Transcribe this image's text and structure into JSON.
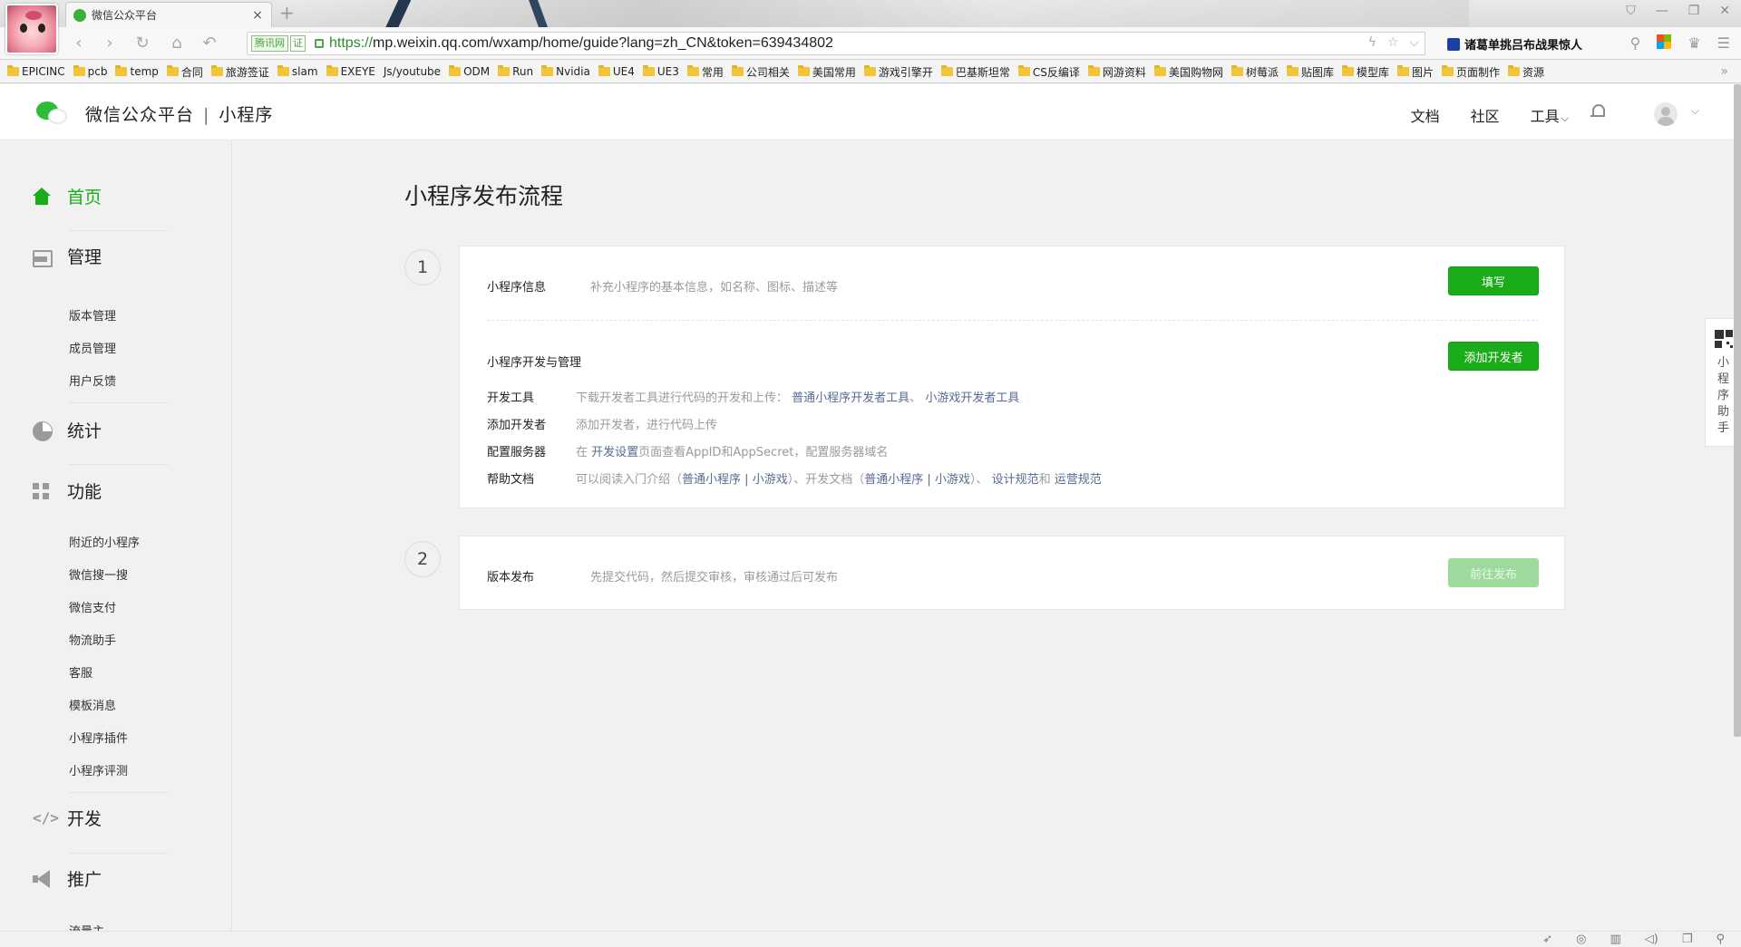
{
  "browser": {
    "tab_title": "微信公众平台",
    "tab_close": "×",
    "tab_new": "+",
    "cert_label": "腾讯网",
    "cert_badge": "证",
    "url_scheme": "https://",
    "url_rest": "mp.weixin.qq.com/wxamp/home/guide?lang=zh_CN&token=639434802",
    "news_headline": "诸葛单挑吕布战果惊人",
    "bookmarks": [
      "EPICINC",
      "pcb",
      "temp",
      "合同",
      "旅游签证",
      "slam",
      "EXEYE",
      "Js/youtube",
      "ODM",
      "Run",
      "Nvidia",
      "UE4",
      "UE3",
      "常用",
      "公司相关",
      "美国常用",
      "游戏引擎开",
      "巴基斯坦常",
      "CS反编译",
      "网游资料",
      "美国购物网",
      "树莓派",
      "贴图库",
      "模型库",
      "图片",
      "页面制作",
      "资源"
    ],
    "bookmark_more": "»"
  },
  "header": {
    "brand": "微信公众平台",
    "separator": "|",
    "product": "小程序",
    "links": {
      "docs": "文档",
      "community": "社区",
      "tools": "工具"
    },
    "tools_caret": "⌵",
    "user_caret": "⌵"
  },
  "sidebar": {
    "home": "首页",
    "manage": "管理",
    "manage_items": [
      "版本管理",
      "成员管理",
      "用户反馈"
    ],
    "stats": "统计",
    "features": "功能",
    "feature_items": [
      "附近的小程序",
      "微信搜一搜",
      "微信支付",
      "物流助手",
      "客服",
      "模板消息",
      "小程序插件",
      "小程序评测"
    ],
    "develop": "开发",
    "develop_icon": "</>",
    "promote": "推广",
    "traffic": "流量主"
  },
  "main": {
    "title": "小程序发布流程",
    "step1": {
      "number": "1",
      "info_title": "小程序信息",
      "info_desc": "补充小程序的基本信息，如名称、图标、描述等",
      "fill_button": "填写",
      "dev_title": "小程序开发与管理",
      "add_dev_button": "添加开发者",
      "rows": {
        "tool_label": "开发工具",
        "tool_text": "下载开发者工具进行代码的开发和上传：",
        "tool_link1": "普通小程序开发者工具",
        "tool_sep": "、",
        "tool_link2": "小游戏开发者工具",
        "add_label": "添加开发者",
        "add_text": "添加开发者，进行代码上传",
        "server_label": "配置服务器",
        "server_pre": "在",
        "server_link": "开发设置",
        "server_post": "页面查看AppID和AppSecret，配置服务器域名",
        "help_label": "帮助文档",
        "help_pre": "可以阅读入门介绍（",
        "help_link1": "普通小程序",
        "help_bar1": "|",
        "help_link2": "小游戏",
        "help_mid": "）、开发文档（",
        "help_link3": "普通小程序",
        "help_bar2": "|",
        "help_link4": "小游戏",
        "help_mid2": "）、",
        "help_link5": "设计规范",
        "help_and": "和",
        "help_link6": "运营规范"
      }
    },
    "step2": {
      "number": "2",
      "title": "版本发布",
      "desc": "先提交代码，然后提交审核，审核通过后可发布",
      "publish_button": "前往发布"
    }
  },
  "helper": {
    "label": "小程序助手"
  },
  "colors": {
    "accent": "#1aad19",
    "link": "#576b95",
    "muted": "#9a9a9a"
  }
}
